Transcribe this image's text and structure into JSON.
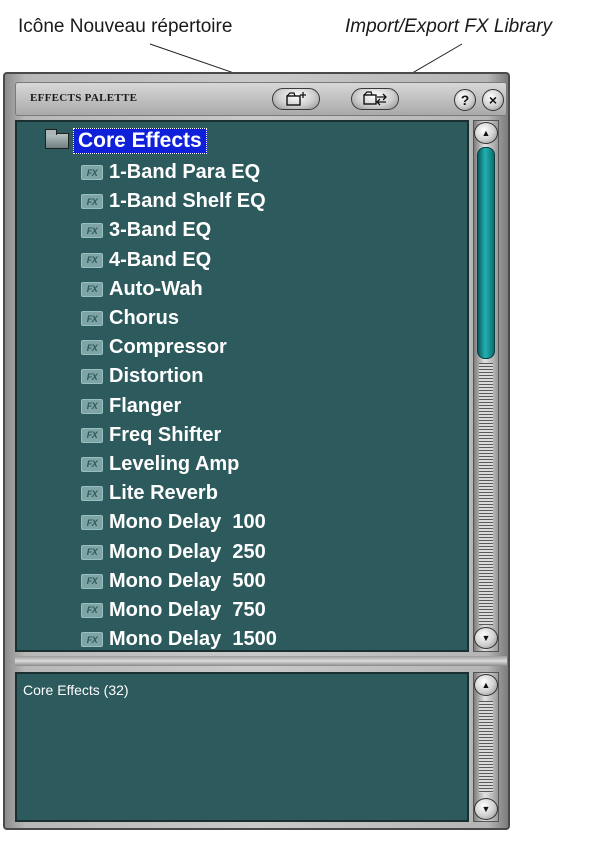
{
  "callouts": {
    "new_folder_icon": "Icône Nouveau répertoire",
    "import_export": "Import/Export FX Library"
  },
  "palette": {
    "title": "EFFECTS PALETTE",
    "buttons": {
      "new_folder": "new-folder-icon",
      "import_export": "import-export-icon",
      "help": "?",
      "close": "×"
    },
    "tree": {
      "folder_label": "Core Effects",
      "item_icon_text": "FX",
      "items": [
        "1-Band Para EQ",
        "1-Band Shelf EQ",
        "3-Band EQ",
        "4-Band EQ",
        "Auto-Wah",
        "Chorus",
        "Compressor",
        "Distortion",
        "Flanger",
        "Freq Shifter",
        "Leveling Amp",
        "Lite Reverb",
        "Mono Delay  100",
        "Mono Delay  250",
        "Mono Delay  500",
        "Mono Delay  750",
        "Mono Delay  1500"
      ]
    },
    "info": {
      "text": "Core Effects (32)"
    },
    "colors": {
      "pane_background": "#2d5a5c",
      "selection": "#1020d8",
      "scroll_thumb": "#21b1b1"
    }
  }
}
